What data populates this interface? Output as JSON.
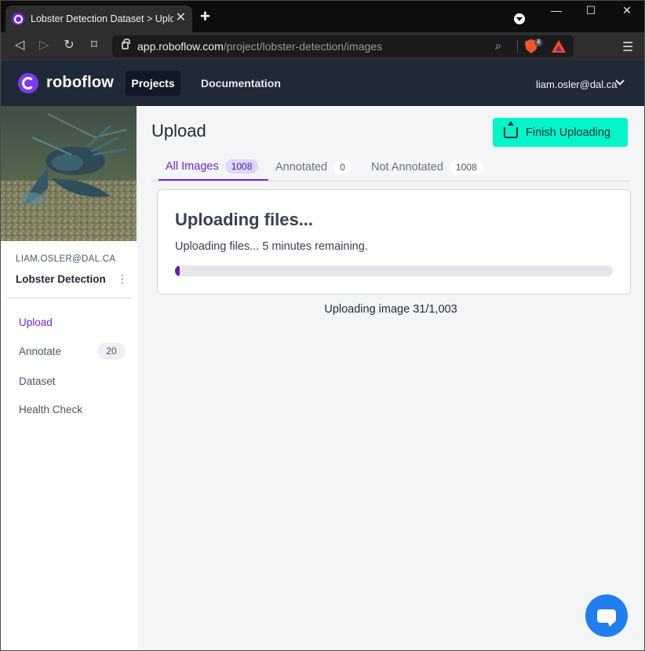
{
  "browser": {
    "tab_title": "Lobster Detection Dataset > Uplo",
    "tab_close": "✕",
    "new_tab": "+",
    "url_host": "app.roboflow.com",
    "url_path": "/project/lobster-detection/images",
    "brave_badge": "4",
    "window_controls": {
      "minimize": "—",
      "maximize": "☐",
      "close": "✕"
    }
  },
  "header": {
    "brand": "roboflow",
    "nav": [
      {
        "label": "Projects",
        "active": true
      },
      {
        "label": "Documentation",
        "active": false
      }
    ],
    "user": "liam.osler@dal.ca"
  },
  "sidebar": {
    "owner": "LIAM.OSLER@DAL.CA",
    "project": "Lobster Detection",
    "items": [
      {
        "label": "Upload",
        "active": true
      },
      {
        "label": "Annotate",
        "badge": "20"
      },
      {
        "label": "Dataset"
      },
      {
        "label": "Health Check"
      }
    ]
  },
  "main": {
    "title": "Upload",
    "finish_button": "Finish Uploading",
    "tabs": [
      {
        "label": "All Images",
        "count": "1008",
        "active": true
      },
      {
        "label": "Annotated",
        "count": "0"
      },
      {
        "label": "Not Annotated",
        "count": "1008"
      }
    ],
    "card": {
      "title": "Uploading files...",
      "subtitle": "Uploading files... 5 minutes remaining.",
      "progress_fraction": 0.009
    },
    "status": "Uploading image 31/1,003"
  },
  "colors": {
    "accent": "#6d28d9",
    "finish_button": "#00f5c8",
    "header_bg": "#1f2937",
    "chat_button": "#1f7ef0"
  }
}
